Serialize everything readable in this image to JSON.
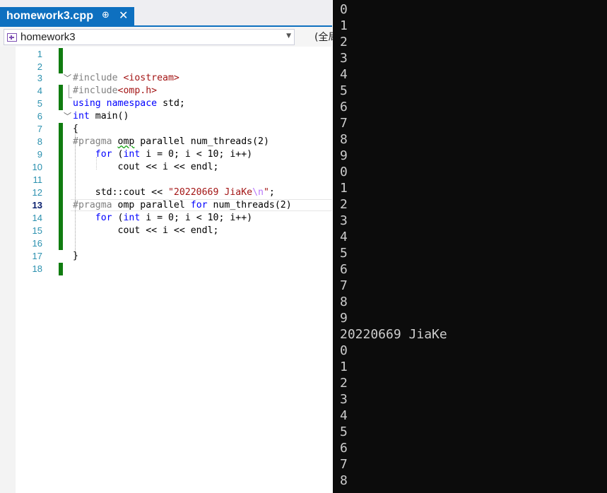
{
  "tab": {
    "title": "homework3.cpp",
    "pin": "⊕",
    "close": "✕"
  },
  "navbar": {
    "project": "homework3",
    "scope": "(全局"
  },
  "editor": {
    "line_numbers": [
      "1",
      "2",
      "3",
      "4",
      "5",
      "6",
      "7",
      "8",
      "9",
      "10",
      "11",
      "12",
      "13",
      "14",
      "15",
      "16",
      "17",
      "18"
    ],
    "current_line": "13",
    "lines": {
      "l3_a": "#include ",
      "l3_b": "<iostream>",
      "l4_a": "#include",
      "l4_b": "<omp.h>",
      "l5_a": "using",
      "l5_b": " ",
      "l5_c": "namespace",
      "l5_d": " std;",
      "l6_a": "int",
      "l6_b": " main()",
      "l7": "{",
      "l8_a": "#pragma ",
      "l8_b": "omp",
      "l8_c": " parallel num_threads(2)",
      "l9_a": "for",
      "l9_b": " (",
      "l9_c": "int",
      "l9_d": " i = 0; i < 10; i++)",
      "l10": "cout << i << endl;",
      "l12_a": "std::cout << ",
      "l12_b": "\"20220669 JiaKe",
      "l12_c": "\\n",
      "l12_d": "\"",
      "l12_e": ";",
      "l13_a": "#pragma ",
      "l13_b": "omp parallel ",
      "l13_c": "for",
      "l13_d": " num_threads(2)",
      "l14_a": "for",
      "l14_b": " (",
      "l14_c": "int",
      "l14_d": " i = 0; i < 10; i++)",
      "l15": "cout << i << endl;",
      "l17": "}"
    }
  },
  "console": {
    "lines": [
      "0",
      "1",
      "2",
      "3",
      "4",
      "5",
      "6",
      "7",
      "8",
      "9",
      "0",
      "1",
      "2",
      "3",
      "4",
      "5",
      "6",
      "7",
      "8",
      "9",
      "20220669 JiaKe",
      "0",
      "1",
      "2",
      "3",
      "4",
      "5",
      "6",
      "7",
      "8"
    ]
  },
  "colors": {
    "accent": "#0e70c0",
    "gutter_mark": "#107c10",
    "console_bg": "#0c0c0c"
  }
}
